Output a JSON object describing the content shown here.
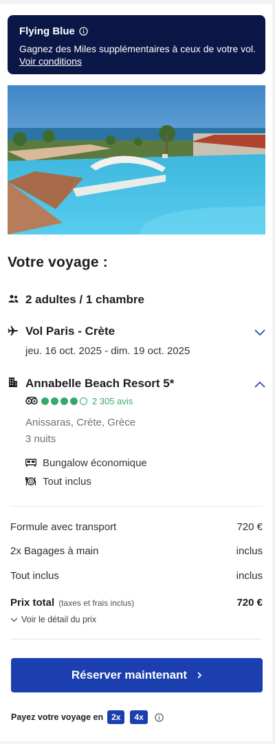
{
  "banner": {
    "title": "Flying Blue",
    "text": "Gagnez des Miles supplémentaires à ceux de votre vol.",
    "link": "Voir conditions",
    "bg_color": "#0b1746"
  },
  "hero": {
    "image": "resort-pool-photo"
  },
  "trip": {
    "heading": "Votre voyage :",
    "travellers": "2 adultes / 1 chambre",
    "flight_title": "Vol Paris - Crète",
    "flight_dates": "jeu. 16 oct. 2025 - dim. 19 oct. 2025",
    "hotel_title": "Annabelle Beach Resort 5*",
    "rating_dots": 4,
    "rating_max": 5,
    "reviews": "2 305 avis",
    "location": "Anissaras, Crète, Grèce",
    "nights": "3 nuits",
    "room": "Bungalow économique",
    "board": "Tout inclus"
  },
  "pricing": {
    "rows": [
      {
        "label": "Formule avec transport",
        "value": "720 €"
      },
      {
        "label": "2x Bagages à main",
        "value": "inclus"
      },
      {
        "label": "Tout inclus",
        "value": "inclus"
      }
    ],
    "total_label": "Prix total",
    "total_note": "(taxes et frais inclus)",
    "total_value": "720 €",
    "detail_link": "Voir le détail du prix"
  },
  "cta": {
    "label": "Réserver maintenant",
    "color": "#1b3fae"
  },
  "payment": {
    "text": "Payez votre voyage en",
    "option1": "2x",
    "option2": "4x"
  },
  "colors": {
    "accent": "#1b3fae",
    "rating": "#34a96b"
  }
}
